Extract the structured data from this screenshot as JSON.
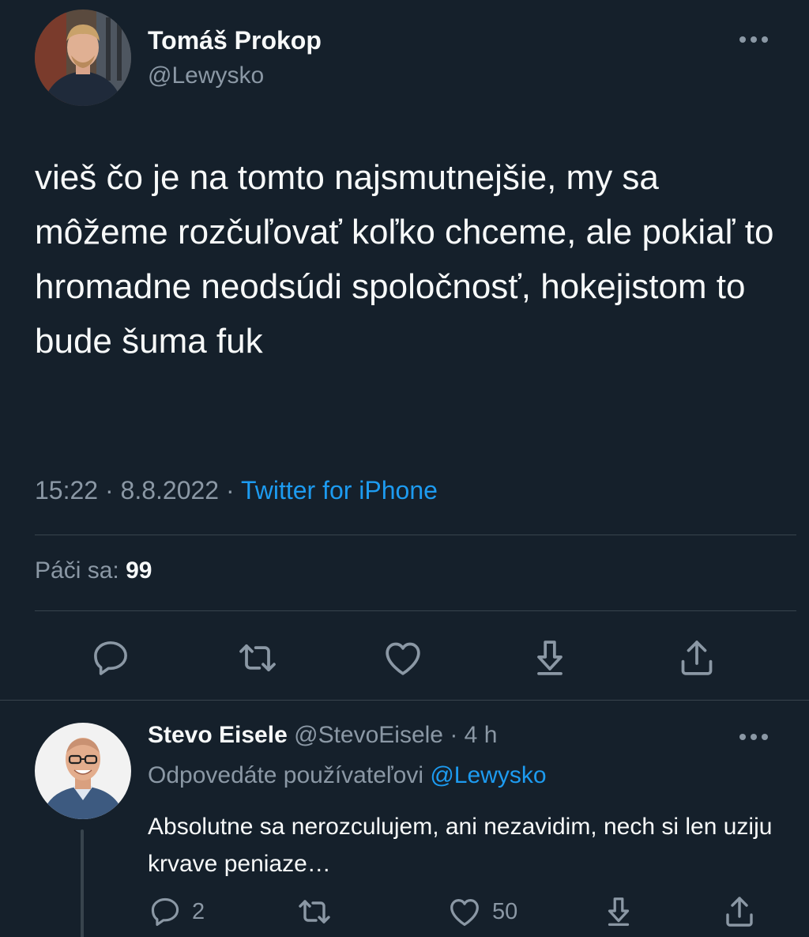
{
  "tweet": {
    "author_name": "Tomáš Prokop",
    "author_handle": "@Lewysko",
    "text": "vieš čo je na tomto najsmutnejšie, my sa môžeme rozčuľovať koľko chceme, ale pokiaľ to hromadne neodsúdi spoločnosť, hokejistom to bude šuma fuk",
    "time": "15:22",
    "separator1": " · ",
    "date": "8.8.2022",
    "separator2": " · ",
    "source": "Twitter for iPhone",
    "likes_label": "Páči sa: ",
    "likes_count": "99",
    "icons": [
      "reply-icon",
      "retweet-icon",
      "like-icon",
      "bookmark-icon",
      "share-icon",
      "more-icon"
    ]
  },
  "reply": {
    "author_name": "Stevo Eisele",
    "author_handle": "@StevoEisele",
    "separator": " · ",
    "time": "4 h",
    "replying_to_label": "Odpovedáte používateľovi ",
    "replying_to_mention": "@Lewysko",
    "text": "Absolutne sa nerozculujem, ani nezavidim, nech si len uziju krvave peniaze…",
    "reply_count": "2",
    "like_count": "50"
  },
  "colors": {
    "background": "#15202b",
    "primary_text": "#f7f9f9",
    "secondary_text": "#8b98a5",
    "accent": "#1d9bf0",
    "divider": "#38444d"
  }
}
